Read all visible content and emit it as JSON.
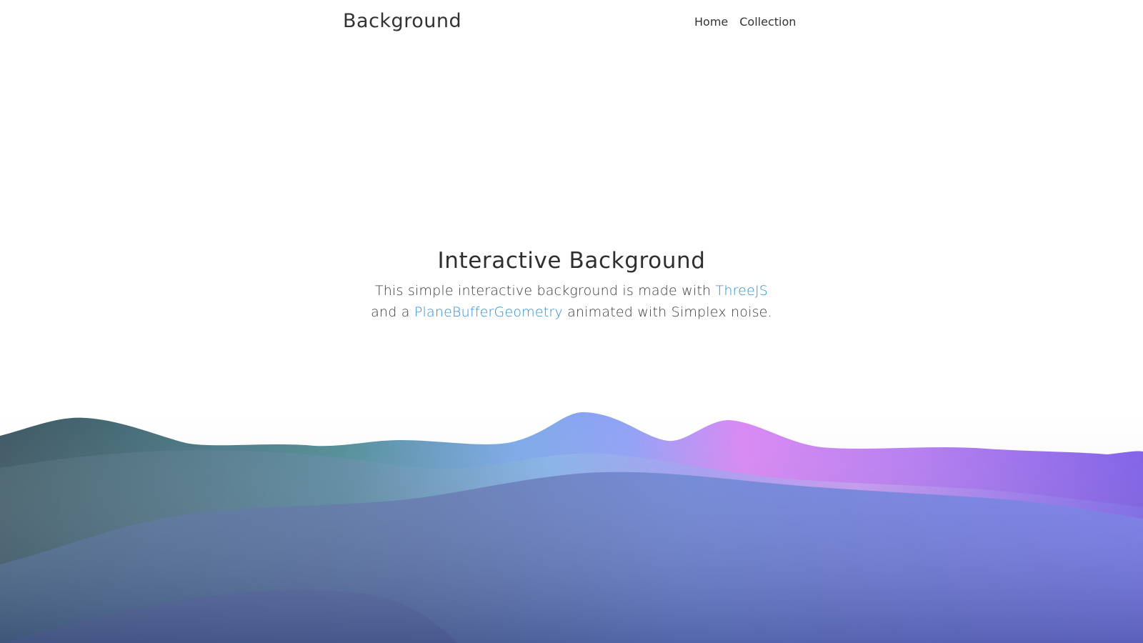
{
  "navbar": {
    "brand": "Background",
    "links": [
      "Home",
      "Collection"
    ]
  },
  "hero": {
    "title": "Interactive Background",
    "line1_before": "This simple interactive background is made with ",
    "link_threejs": "ThreeJS",
    "line2_before": "and a ",
    "link_geometry": "PlaneBufferGeometry",
    "line2_after": " animated with Simplex noise."
  },
  "colors": {
    "link": "#2f8fd0",
    "text": "#333333",
    "wave_teal": "#3d5f68",
    "wave_blue": "#7ea0f0",
    "wave_pink": "#d27bf2",
    "wave_purple": "#8a6ff2"
  }
}
